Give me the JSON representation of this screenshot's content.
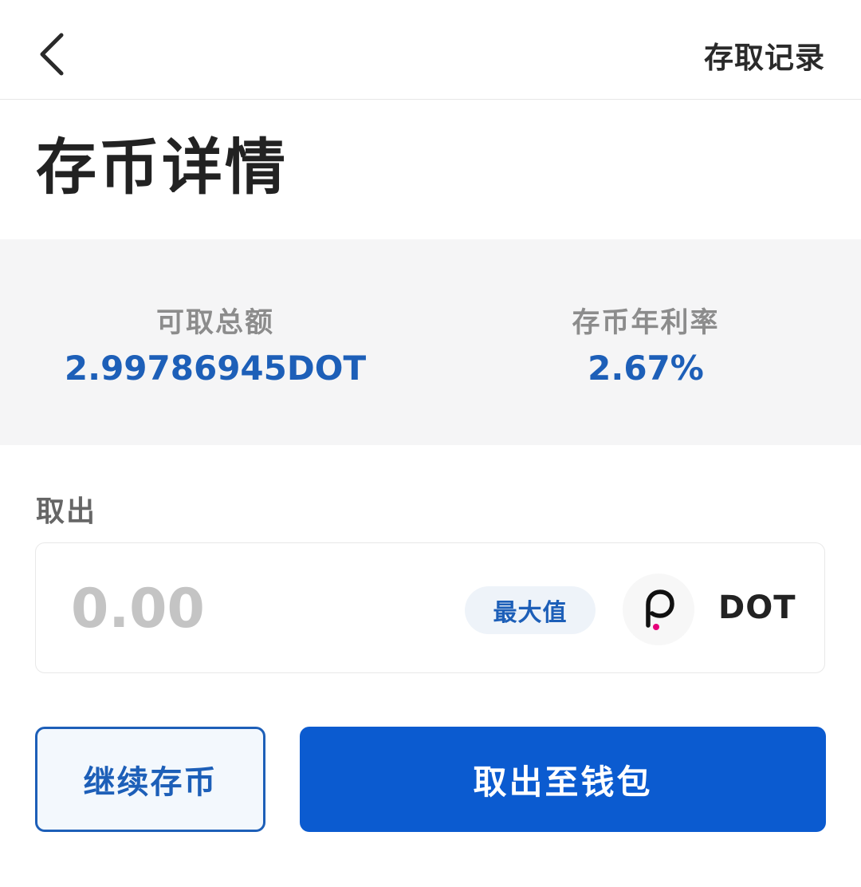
{
  "header": {
    "back_icon": "chevron-left-icon",
    "records_label": "存取记录"
  },
  "page": {
    "title": "存币详情"
  },
  "summary": {
    "available_label": "可取总额",
    "available_value": "2.99786945DOT",
    "rate_label": "存币年利率",
    "rate_value": "2.67%",
    "accent_color": "#1d5fb8"
  },
  "withdraw": {
    "label": "取出",
    "amount_placeholder": "0.00",
    "amount_value": "",
    "max_label": "最大值",
    "token_icon": "polkadot-icon",
    "token_symbol": "DOT"
  },
  "actions": {
    "continue_label": "继续存币",
    "withdraw_label": "取出至钱包",
    "primary_color": "#0b5bd0"
  }
}
